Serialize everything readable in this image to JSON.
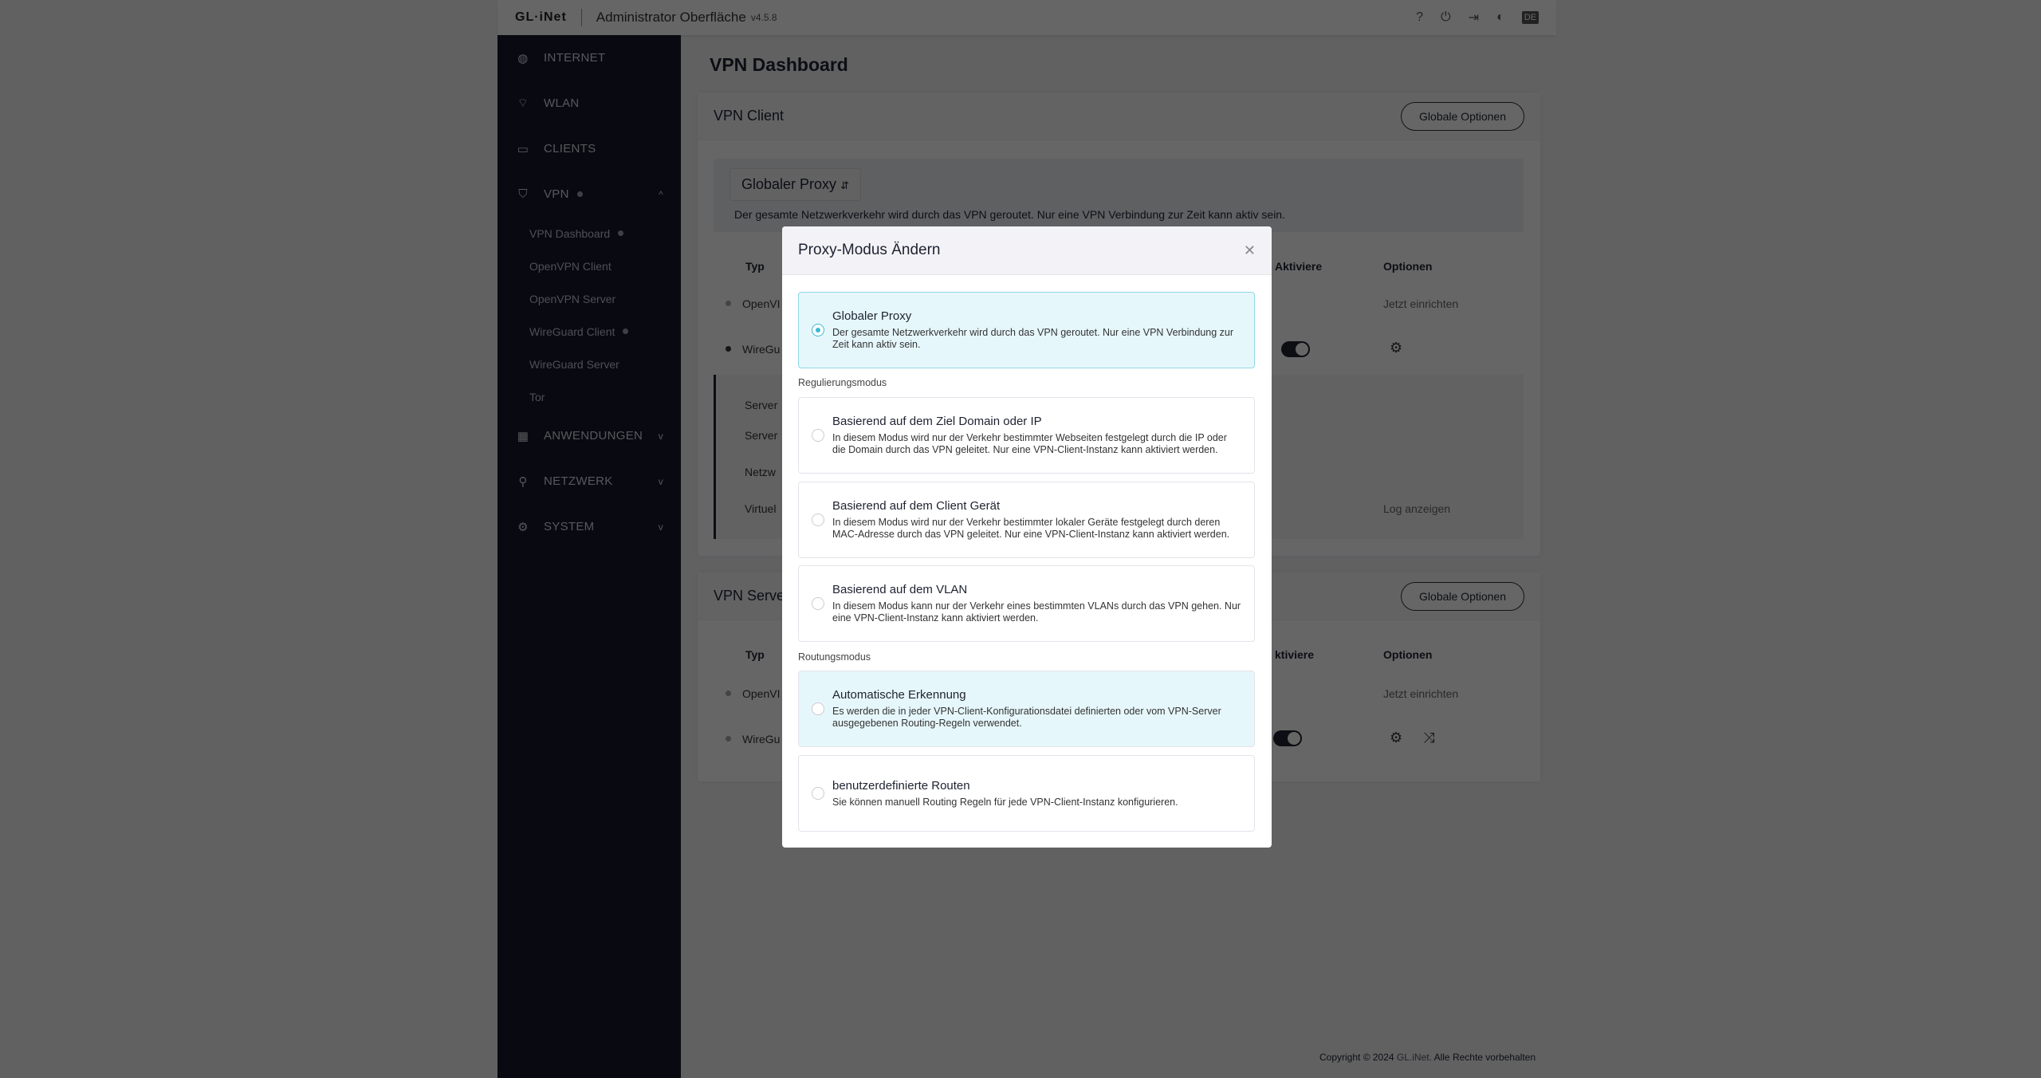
{
  "header": {
    "logo": "GL·iNet",
    "title": "Administrator Oberfläche",
    "version": "v4.5.8",
    "lang": "DE",
    "icons": [
      "help-icon",
      "power-icon",
      "logout-icon",
      "theme-icon"
    ]
  },
  "sidebar": {
    "items": [
      {
        "label": "INTERNET",
        "icon": "globe-icon"
      },
      {
        "label": "WLAN",
        "icon": "wifi-icon"
      },
      {
        "label": "CLIENTS",
        "icon": "devices-icon"
      },
      {
        "label": "VPN",
        "icon": "shield-icon"
      },
      {
        "label": "ANWENDUNGEN",
        "icon": "apps-icon"
      },
      {
        "label": "NETZWERK",
        "icon": "network-icon"
      },
      {
        "label": "SYSTEM",
        "icon": "gear-icon"
      }
    ],
    "vpn_sub": [
      "VPN Dashboard",
      "OpenVPN Client",
      "OpenVPN Server",
      "WireGuard Client",
      "WireGuard Server",
      "Tor"
    ]
  },
  "main": {
    "title": "VPN Dashboard",
    "client": {
      "title": "VPN Client",
      "button": "Globale Optionen",
      "proxy_mode": "Globaler Proxy",
      "proxy_desc": "Der gesamte Netzwerkverkehr wird durch das VPN geroutet. Nur eine VPN Verbindung zur Zeit kann aktiv sein.",
      "headers": {
        "type": "Typ",
        "enable": "Aktiviere",
        "options": "Optionen"
      },
      "rows": [
        {
          "type": "OpenVI",
          "option": "Jetzt einrichten"
        },
        {
          "type": "WireGu",
          "enabled": true
        }
      ],
      "expand_labels": [
        "Server",
        "Server",
        "Netzw",
        "Virtuel"
      ],
      "log": "Log anzeigen"
    },
    "server": {
      "title": "VPN Serve",
      "button": "Globale Optionen",
      "headers": {
        "type": "Typ",
        "enable": "ktiviere",
        "options": "Optionen"
      },
      "rows": [
        {
          "type": "OpenVI",
          "option": "Jetzt einrichten"
        },
        {
          "type": "WireGu",
          "enabled": true
        }
      ]
    }
  },
  "footer": {
    "prefix": "Copyright © 2024 ",
    "brand": "GL.iNet.",
    "suffix": " Alle Rechte vorbehalten"
  },
  "modal": {
    "title": "Proxy-Modus Ändern",
    "global": {
      "title": "Globaler Proxy",
      "desc": "Der gesamte Netzwerkverkehr wird durch das VPN geroutet. Nur eine VPN Verbindung zur Zeit kann aktiv sein.",
      "selected": true
    },
    "reg_label": "Regulierungsmodus",
    "reg": [
      {
        "title": "Basierend auf dem Ziel Domain oder IP",
        "desc": "In diesem Modus wird nur der Verkehr bestimmter Webseiten festgelegt durch die IP oder die Domain durch das VPN geleitet. Nur eine VPN-Client-Instanz kann aktiviert werden."
      },
      {
        "title": "Basierend auf dem Client Gerät",
        "desc": "In diesem Modus wird nur der Verkehr bestimmter lokaler Geräte festgelegt durch deren MAC-Adresse durch das VPN geleitet. Nur eine VPN-Client-Instanz kann aktiviert werden."
      },
      {
        "title": "Basierend auf dem VLAN",
        "desc": "In diesem Modus kann nur der Verkehr eines bestimmten VLANs durch das VPN gehen. Nur eine VPN-Client-Instanz kann aktiviert werden."
      }
    ],
    "route_label": "Routungsmodus",
    "route": [
      {
        "title": "Automatische Erkennung",
        "desc": "Es werden die in jeder VPN-Client-Konfigurationsdatei definierten oder vom VPN-Server ausgegebenen Routing-Regeln verwendet."
      },
      {
        "title": "benutzerdefinierte Routen",
        "desc": "Sie können manuell Routing Regeln für jede VPN-Client-Instanz konfigurieren."
      }
    ]
  }
}
